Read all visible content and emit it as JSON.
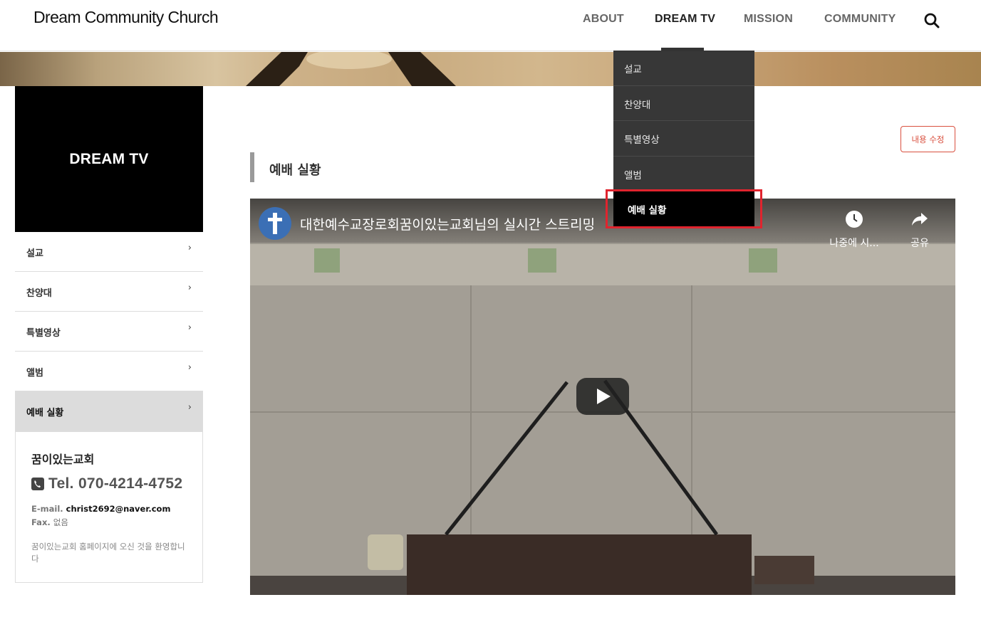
{
  "header": {
    "logo": "Dream Community Church",
    "nav": [
      "ABOUT",
      "DREAM TV",
      "MISSION",
      "COMMUNITY"
    ],
    "active_nav": "DREAM TV",
    "search_icon": "search-icon"
  },
  "dropdown": {
    "items": [
      "설교",
      "찬양대",
      "특별영상",
      "앨범",
      "예배 실황"
    ],
    "selected": "예배 실황"
  },
  "sidebar": {
    "hero_title": "DREAM TV",
    "items": [
      "설교",
      "찬양대",
      "특별영상",
      "앨범",
      "예배 실황"
    ],
    "active_item": "예배 실황",
    "chevron": "›",
    "info": {
      "church_name": "꿈이있는교회",
      "tel": "Tel. 070-4214-4752",
      "email_label": "E-mail.",
      "email": "christ2692@naver.com",
      "fax_label": "Fax.",
      "fax": "없음",
      "welcome": "꿈이있는교회 홈페이지에 오신 것을 환영합니다"
    }
  },
  "main": {
    "edit_button": "내용 수정",
    "section_title": "예배 실황",
    "video": {
      "title": "대한예수교장로회꿈이있는교회님의 실시간 스트리밍",
      "watch_later": "나중에 시...",
      "share": "공유"
    }
  },
  "colors": {
    "accent_red": "#d9503f",
    "highlight_red": "#e0242e",
    "dropdown_bg": "#373737",
    "sidebar_active_bg": "#dcdcdc"
  }
}
